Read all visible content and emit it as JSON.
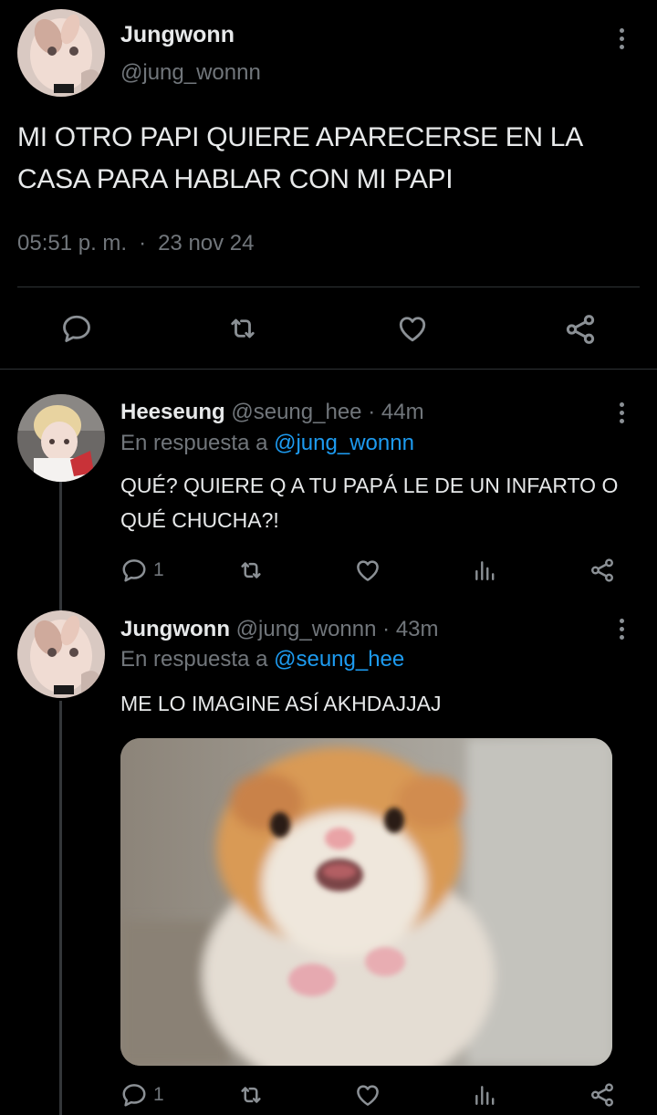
{
  "main_tweet": {
    "author_name": "Jungwonn",
    "author_handle": "@jung_wonnn",
    "text": "MI OTRO PAPI QUIERE APARECERSE EN LA CASA PARA HABLAR CON MI PAPI",
    "time": "05:51 p. m.",
    "separator": "·",
    "date": "23 nov 24",
    "actions": [
      "reply-icon",
      "retweet-icon",
      "like-icon",
      "share-icon"
    ]
  },
  "replies": [
    {
      "author_name": "Heeseung",
      "author_handle": "@seung_hee",
      "separator": "·",
      "time": "44m",
      "reply_prefix": "En respuesta a ",
      "reply_to": "@jung_wonnn",
      "text": "QUÉ? QUIERE Q A TU PAPÁ LE DE UN INFARTO O QUÉ CHUCHA?!",
      "reply_count": "1"
    },
    {
      "author_name": "Jungwonn",
      "author_handle": "@jung_wonnn",
      "separator": "·",
      "time": "43m",
      "reply_prefix": "En respuesta a ",
      "reply_to": "@seung_hee",
      "text": "ME LO IMAGINE ASÍ AKHDAJJAJ",
      "reply_count": "1",
      "media": "hamster-photo"
    }
  ],
  "colors": {
    "background": "#000000",
    "text": "#e7e9ea",
    "secondary": "#71767b",
    "accent": "#1d9bf0",
    "divider": "#2f3336"
  }
}
